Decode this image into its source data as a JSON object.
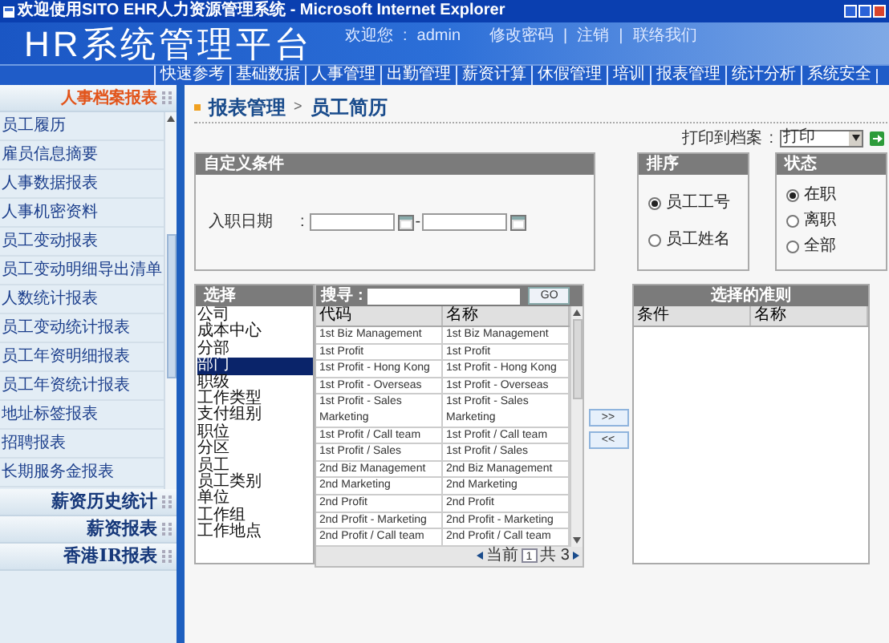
{
  "window": {
    "title": "欢迎使用SITO EHR人力资源管理系统 - Microsoft Internet Explorer"
  },
  "header": {
    "logo": "HR系统管理平台",
    "welcome": "欢迎您",
    "colon": ":",
    "user": "admin",
    "links": [
      "修改密码",
      "|",
      "注销",
      "|",
      "联络我们"
    ]
  },
  "nav": [
    "快速参考",
    "基础数据",
    "人事管理",
    "出勤管理",
    "薪资计算",
    "休假管理",
    "培训",
    "报表管理",
    "统计分析",
    "系统安全"
  ],
  "sidebar": {
    "sections": [
      {
        "title": "人事档案报表",
        "expanded": true,
        "items": [
          "员工履历",
          "雇员信息摘要",
          "人事数据报表",
          "人事机密资料",
          "员工变动报表",
          "员工变动明细导出清单",
          "人数统计报表",
          "员工变动统计报表",
          "员工年资明细报表",
          "员工年资统计报表",
          "地址标签报表",
          "招聘报表",
          "长期服务金报表"
        ]
      },
      {
        "title": "薪资历史统计",
        "expanded": false
      },
      {
        "title": "薪资报表",
        "expanded": false
      },
      {
        "title": "香港IR报表",
        "expanded": false
      }
    ]
  },
  "breadcrumb": [
    "报表管理",
    ">",
    "员工简历"
  ],
  "print": {
    "label": "打印到档案",
    "colon": ":",
    "value": "打印"
  },
  "custom_conditions": {
    "title": "自定义条件",
    "label": "入职日期",
    "colon": ":",
    "separator": "-"
  },
  "sort": {
    "title": "排序",
    "options": [
      {
        "label": "员工工号",
        "selected": true
      },
      {
        "label": "员工姓名",
        "selected": false
      }
    ]
  },
  "status": {
    "title": "状态",
    "options": [
      {
        "label": "在职",
        "selected": true
      },
      {
        "label": "离职",
        "selected": false
      },
      {
        "label": "全部",
        "selected": false
      }
    ]
  },
  "choose": {
    "title": "选择",
    "items": [
      {
        "label": "公司",
        "selected": false
      },
      {
        "label": "成本中心",
        "selected": false
      },
      {
        "label": "分部",
        "selected": false
      },
      {
        "label": "部门",
        "selected": true
      },
      {
        "label": "职级",
        "selected": false
      },
      {
        "label": "工作类型",
        "selected": false
      },
      {
        "label": "支付组别",
        "selected": false
      },
      {
        "label": "职位",
        "selected": false
      },
      {
        "label": "分区",
        "selected": false
      },
      {
        "label": "员工",
        "selected": false
      },
      {
        "label": "员工类别",
        "selected": false
      },
      {
        "label": "单位",
        "selected": false
      },
      {
        "label": "工作组",
        "selected": false
      },
      {
        "label": "工作地点",
        "selected": false
      }
    ]
  },
  "search": {
    "label": "搜寻",
    "colon": ":",
    "button": "GO"
  },
  "table": {
    "columns": [
      "代码",
      "名称"
    ],
    "rows": [
      [
        "1st Biz Management",
        "1st Biz Management"
      ],
      [
        "1st Profit",
        "1st Profit"
      ],
      [
        "1st Profit - Hong Kong",
        "1st Profit - Hong Kong"
      ],
      [
        "1st Profit - Overseas",
        "1st Profit - Overseas"
      ],
      [
        "1st Profit - Sales Marketing",
        "1st Profit - Sales Marketing"
      ],
      [
        "1st Profit / Call team",
        "1st Profit / Call team"
      ],
      [
        "1st Profit / Sales",
        "1st Profit / Sales"
      ],
      [
        "2nd Biz Management",
        "2nd Biz Management"
      ],
      [
        "2nd Marketing",
        "2nd Marketing"
      ],
      [
        "2nd Profit",
        "2nd Profit"
      ],
      [
        "2nd Profit - Marketing",
        "2nd Profit - Marketing"
      ],
      [
        "2nd Profit / Call team",
        "2nd Profit / Call team"
      ]
    ]
  },
  "pager": {
    "current_label": "当前",
    "page": "1",
    "total": "共 3"
  },
  "move_buttons": [
    ">>",
    "<<"
  ],
  "selected_criteria": {
    "title": "选择的准则",
    "columns": [
      "条件",
      "名称"
    ]
  }
}
